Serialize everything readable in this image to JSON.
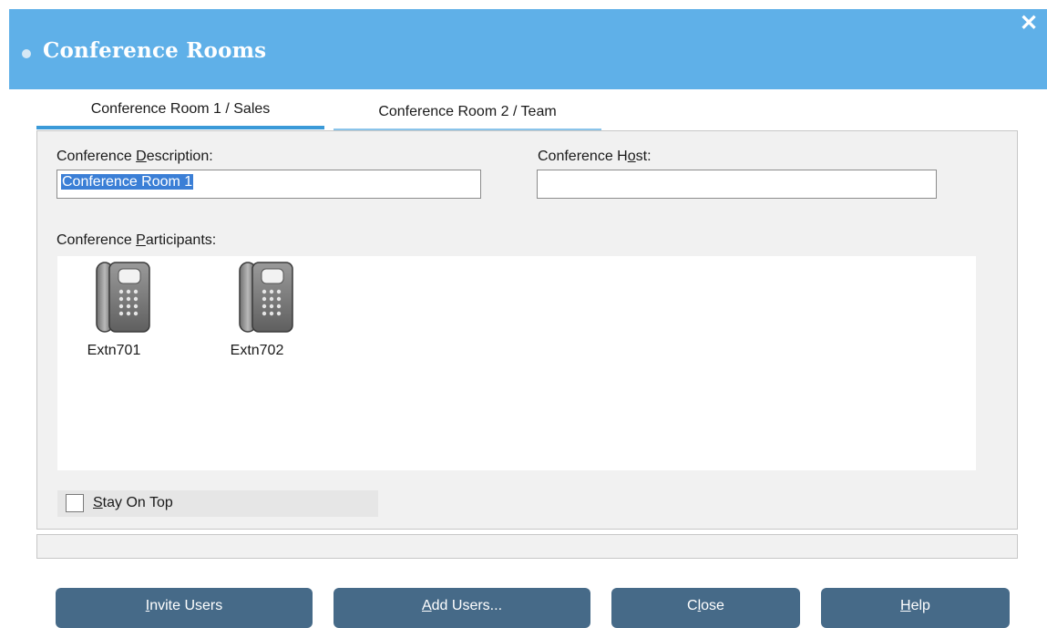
{
  "window": {
    "title": "Conference Rooms",
    "close_glyph": "✕"
  },
  "tabs": [
    {
      "label": "Conference Room 1 / Sales",
      "selected": true
    },
    {
      "label": "Conference Room 2 / Team",
      "selected": false
    }
  ],
  "form": {
    "description_label_pre": "Conference ",
    "description_label_key": "D",
    "description_label_post": "escription:",
    "description_value": "Conference Room 1",
    "host_label_pre": "Conference H",
    "host_label_key": "o",
    "host_label_post": "st:",
    "host_value": "",
    "participants_label_pre": "Conference ",
    "participants_label_key": "P",
    "participants_label_post": "articipants:"
  },
  "participants": [
    {
      "name": "Extn701",
      "icon": "desk-phone-icon"
    },
    {
      "name": "Extn702",
      "icon": "desk-phone-icon"
    }
  ],
  "stay_on_top": {
    "key": "S",
    "rest": "tay On Top",
    "checked": false
  },
  "buttons": {
    "invite": {
      "key": "I",
      "rest": "nvite Users"
    },
    "add": {
      "key": "A",
      "rest": "dd Users..."
    },
    "close": {
      "pre": "C",
      "key": "l",
      "rest": "ose"
    },
    "help": {
      "key": "H",
      "rest": "elp"
    }
  },
  "colors": {
    "titlebar": "#5fb0e8",
    "button": "#466a88",
    "tab_accent": "#3b9ad8"
  }
}
